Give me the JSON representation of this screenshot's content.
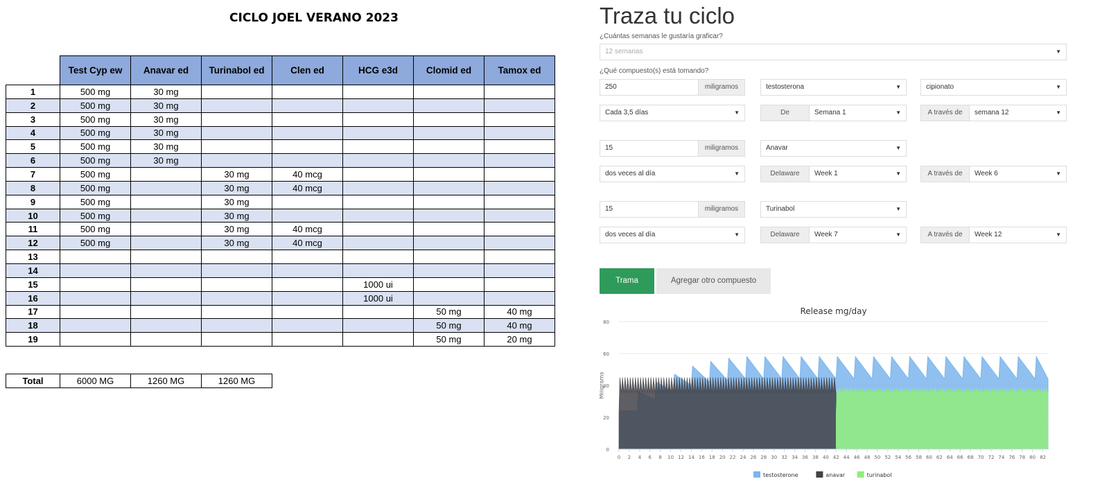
{
  "sheet": {
    "title": "CICLO JOEL VERANO 2023",
    "headers": [
      "Test Cyp ew",
      "Anavar ed",
      "Turinabol ed",
      "Clen ed",
      "HCG e3d",
      "Clomid ed",
      "Tamox ed"
    ],
    "rows": [
      [
        "1",
        "500 mg",
        "30 mg",
        "",
        "",
        "",
        "",
        ""
      ],
      [
        "2",
        "500 mg",
        "30 mg",
        "",
        "",
        "",
        "",
        ""
      ],
      [
        "3",
        "500 mg",
        "30 mg",
        "",
        "",
        "",
        "",
        ""
      ],
      [
        "4",
        "500 mg",
        "30 mg",
        "",
        "",
        "",
        "",
        ""
      ],
      [
        "5",
        "500 mg",
        "30 mg",
        "",
        "",
        "",
        "",
        ""
      ],
      [
        "6",
        "500 mg",
        "30 mg",
        "",
        "",
        "",
        "",
        ""
      ],
      [
        "7",
        "500 mg",
        "",
        "30 mg",
        "40 mcg",
        "",
        "",
        ""
      ],
      [
        "8",
        "500 mg",
        "",
        "30 mg",
        "40 mcg",
        "",
        "",
        ""
      ],
      [
        "9",
        "500 mg",
        "",
        "30 mg",
        "",
        "",
        "",
        ""
      ],
      [
        "10",
        "500 mg",
        "",
        "30 mg",
        "",
        "",
        "",
        ""
      ],
      [
        "11",
        "500 mg",
        "",
        "30 mg",
        "40 mcg",
        "",
        "",
        ""
      ],
      [
        "12",
        "500 mg",
        "",
        "30 mg",
        "40 mcg",
        "",
        "",
        ""
      ],
      [
        "13",
        "",
        "",
        "",
        "",
        "",
        "",
        ""
      ],
      [
        "14",
        "",
        "",
        "",
        "",
        "",
        "",
        ""
      ],
      [
        "15",
        "",
        "",
        "",
        "",
        "1000 ui",
        "",
        ""
      ],
      [
        "16",
        "",
        "",
        "",
        "",
        "1000 ui",
        "",
        ""
      ],
      [
        "17",
        "",
        "",
        "",
        "",
        "",
        "50 mg",
        "40 mg"
      ],
      [
        "18",
        "",
        "",
        "",
        "",
        "",
        "50 mg",
        "40 mg"
      ],
      [
        "19",
        "",
        "",
        "",
        "",
        "",
        "50 mg",
        "20 mg"
      ]
    ],
    "total_label": "Total",
    "totals": [
      "6000 MG",
      "1260 MG",
      "1260 MG"
    ]
  },
  "panel": {
    "title": "Traza tu ciclo",
    "weeks_question": "¿Cuántas semanas le gustaría graficar?",
    "weeks_value": "12 semanas",
    "compounds_question": "¿Qué compuesto(s) está tomando?",
    "compounds": [
      {
        "dose": "250",
        "unit": "miligramos",
        "compound": "testosterona",
        "ester": "cipionato",
        "frequency": "Cada 3,5 días",
        "from_label": "De",
        "from_value": "Semana 1",
        "to_label": "A través de",
        "to_value": "semana 12"
      },
      {
        "dose": "15",
        "unit": "miligramos",
        "compound": "Anavar",
        "ester": "",
        "frequency": "dos veces al día",
        "from_label": "Delaware",
        "from_value": "Week 1",
        "to_label": "A través de",
        "to_value": "Week 6"
      },
      {
        "dose": "15",
        "unit": "miligramos",
        "compound": "Turinabol",
        "ester": "",
        "frequency": "dos veces al día",
        "from_label": "Delaware",
        "from_value": "Week 7",
        "to_label": "A través de",
        "to_value": "Week 12"
      }
    ],
    "plot_button": "Trama",
    "add_button": "Agregar otro compuesto"
  },
  "chart_data": {
    "type": "area",
    "title": "Release mg/day",
    "ylabel": "Miligrams",
    "xlabel": "",
    "xlim": [
      0,
      83
    ],
    "ylim": [
      0,
      80
    ],
    "yticks": [
      0,
      20,
      40,
      60,
      80
    ],
    "xticks": [
      0,
      2,
      4,
      6,
      8,
      10,
      12,
      14,
      16,
      18,
      20,
      22,
      24,
      26,
      28,
      30,
      32,
      34,
      36,
      38,
      40,
      42,
      44,
      46,
      48,
      50,
      52,
      54,
      56,
      58,
      60,
      62,
      64,
      66,
      68,
      70,
      72,
      74,
      76,
      78,
      80,
      82
    ],
    "grid": true,
    "legend_position": "bottom",
    "series": [
      {
        "name": "testosterone",
        "color": "#7cb5ec",
        "x": [
          0,
          3.5,
          7,
          10.5,
          14,
          17.5,
          21,
          24.5,
          28,
          31.5,
          35,
          38.5,
          42,
          45.5,
          49,
          52.5,
          56,
          59.5,
          63,
          66.5,
          70,
          73.5,
          77,
          80.5,
          83
        ],
        "peaks": [
          24,
          36,
          42,
          47,
          52,
          55,
          57,
          58,
          58,
          58,
          58,
          58,
          58,
          58,
          58,
          58,
          58,
          58,
          58,
          58,
          58,
          58,
          58,
          58
        ],
        "troughs": [
          0,
          24,
          31,
          36,
          40,
          42,
          43,
          44,
          44,
          44,
          44,
          44,
          44,
          44,
          44,
          44,
          44,
          44,
          44,
          44,
          44,
          44,
          44,
          44
        ]
      },
      {
        "name": "anavar",
        "color": "#434348",
        "x_range": [
          0,
          42
        ],
        "peak": 45,
        "trough": 35,
        "doses_per_day": 2
      },
      {
        "name": "turinabol",
        "color": "#90ed7d",
        "x_range": [
          42,
          83
        ],
        "peak": 38,
        "trough": 35,
        "doses_per_day": 2
      }
    ]
  },
  "chart_colors": {
    "grid": "#e6e6e6",
    "axis": "#ccd6eb",
    "label": "#666666"
  }
}
